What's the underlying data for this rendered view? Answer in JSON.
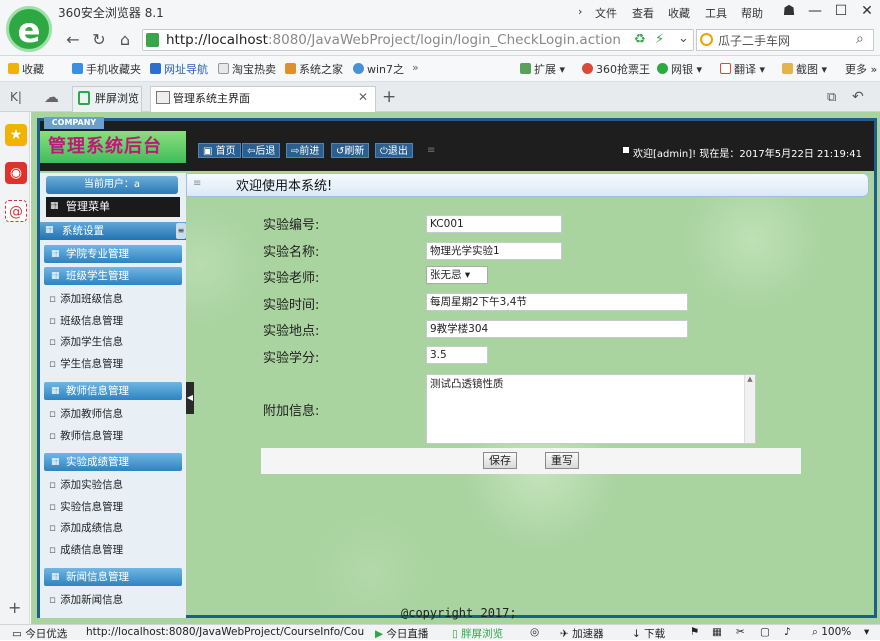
{
  "browser": {
    "app_title": "360安全浏览器 8.1",
    "top_menu": [
      "文件",
      "查看",
      "收藏",
      "工具",
      "帮助"
    ],
    "url_host": "http://localhost",
    "url_rest": ":8080/JavaWebProject/login/login_CheckLogin.action",
    "search_placeholder": "瓜子二手车网",
    "bookmarks": [
      "收藏",
      "手机收藏夹",
      "网址导航",
      "淘宝热卖",
      "系统之家",
      "win7之",
      "扩展",
      "360抢票王",
      "网银",
      "翻译",
      "截图",
      "更多"
    ],
    "tabs": [
      "胖屏浏览",
      "管理系统主界面"
    ]
  },
  "header": {
    "company": "COMPANY",
    "brand": "管理系统后台",
    "buttons": [
      "首页",
      "后退",
      "前进",
      "刷新",
      "退出"
    ],
    "welcome": "欢迎[admin]!  现在是：2017年5月22日 21:19:41"
  },
  "sidebar": {
    "current_user": "当前用户：a",
    "menu_title": "管理菜单",
    "system": "系统设置",
    "groups": [
      {
        "title": "学院专业管理",
        "items": []
      },
      {
        "title": "班级学生管理",
        "items": [
          "添加班级信息",
          "班级信息管理",
          "添加学生信息",
          "学生信息管理"
        ]
      },
      {
        "title": "教师信息管理",
        "items": [
          "添加教师信息",
          "教师信息管理"
        ]
      },
      {
        "title": "实验成绩管理",
        "items": [
          "添加实验信息",
          "实验信息管理",
          "添加成绩信息",
          "成绩信息管理"
        ]
      },
      {
        "title": "新闻信息管理",
        "items": [
          "添加新闻信息"
        ]
      }
    ]
  },
  "main": {
    "welcome": "欢迎使用本系统!",
    "form": {
      "labels": [
        "实验编号:",
        "实验名称:",
        "实验老师:",
        "实验时间:",
        "实验地点:",
        "实验学分:",
        "附加信息:"
      ],
      "code": "KC001",
      "name": "物理光学实验1",
      "teacher": "张无忌",
      "time": "每周星期2下午3,4节",
      "place": "9教学楼304",
      "credit": "3.5",
      "extra": "测试凸透镜性质"
    },
    "save": "保存",
    "reset": "重写",
    "copyright": "@copyright 2017;"
  },
  "statusbar": {
    "left": "今日优选",
    "url": "http://localhost:8080/JavaWebProject/CourseInfo/Cou",
    "live": "今日直播",
    "wide": "胖屏浏览",
    "accel": "加速器",
    "download": "下载",
    "zoom": "100%"
  }
}
